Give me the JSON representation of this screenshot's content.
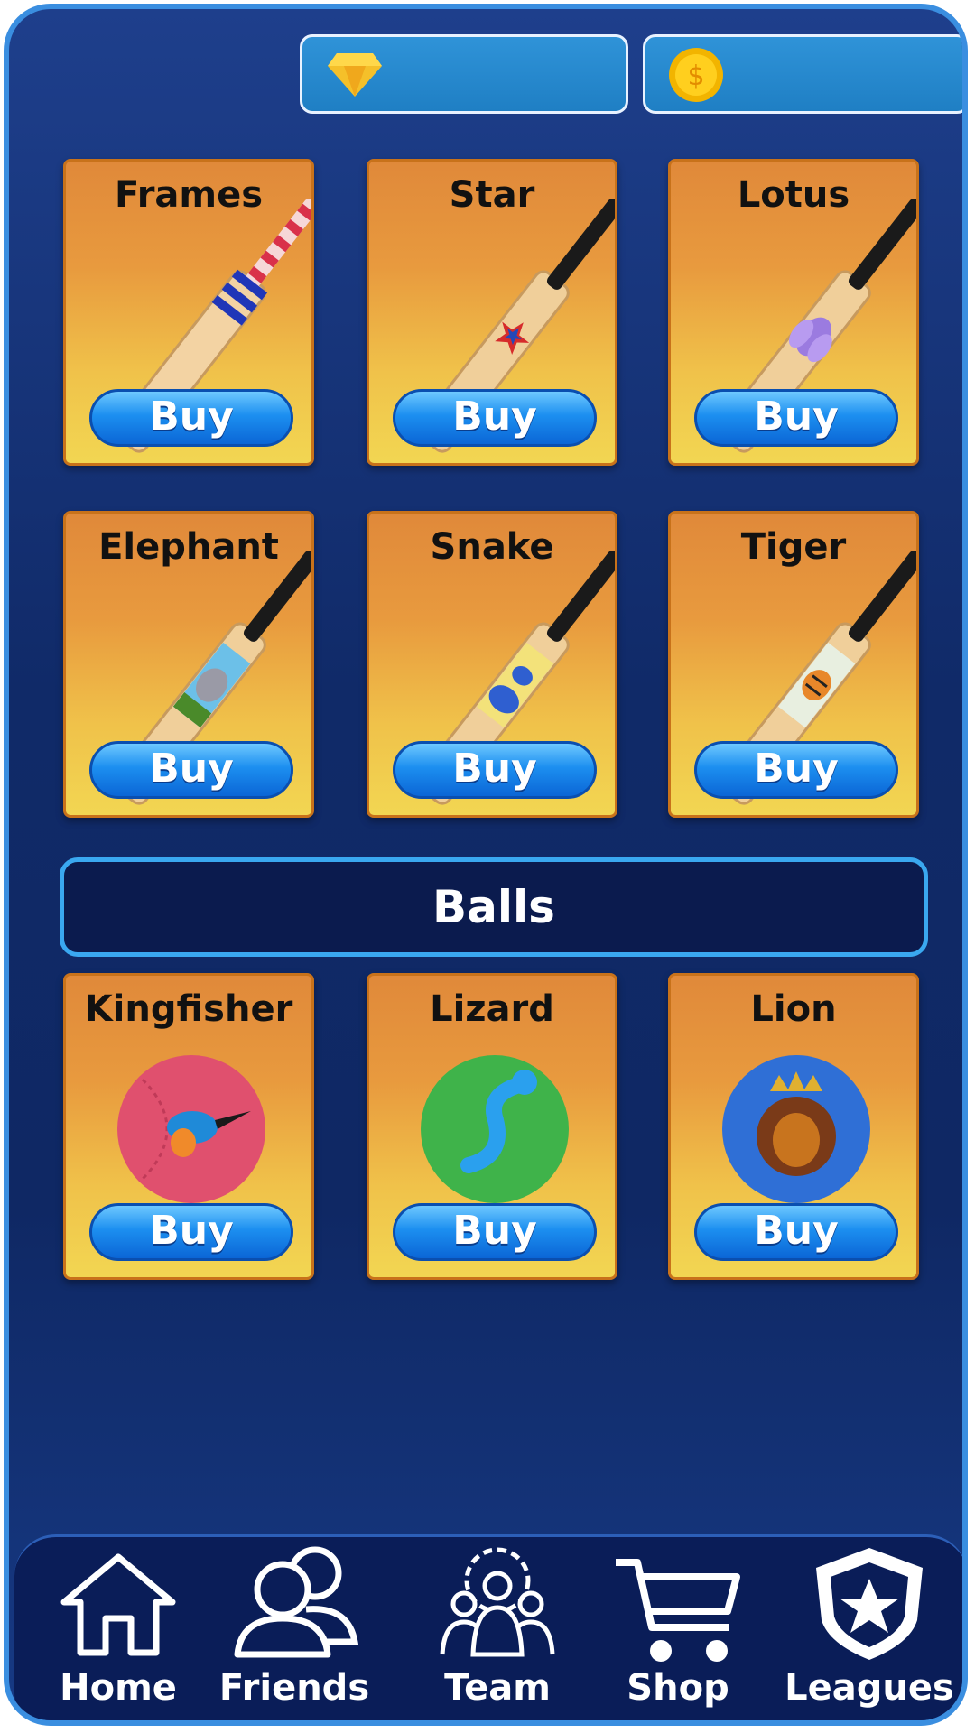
{
  "currency": {
    "gems": {
      "icon": "diamond-icon",
      "value": ""
    },
    "coins": {
      "icon": "coin-icon",
      "value": ""
    }
  },
  "bats": [
    {
      "name": "Frames",
      "button": "Buy",
      "icon": "bat-frames-icon"
    },
    {
      "name": "Star",
      "button": "Buy",
      "icon": "bat-star-icon"
    },
    {
      "name": "Lotus",
      "button": "Buy",
      "icon": "bat-lotus-icon"
    },
    {
      "name": "Elephant",
      "button": "Buy",
      "icon": "bat-elephant-icon"
    },
    {
      "name": "Snake",
      "button": "Buy",
      "icon": "bat-snake-icon"
    },
    {
      "name": "Tiger",
      "button": "Buy",
      "icon": "bat-tiger-icon"
    }
  ],
  "balls_section": {
    "title": "Balls"
  },
  "balls": [
    {
      "name": "Kingfisher",
      "button": "Buy",
      "icon": "ball-kingfisher-icon",
      "color": "#e0506e"
    },
    {
      "name": "Lizard",
      "button": "Buy",
      "icon": "ball-lizard-icon",
      "color": "#3fb34a"
    },
    {
      "name": "Lion",
      "button": "Buy",
      "icon": "ball-lion-icon",
      "color": "#2f6fd6"
    }
  ],
  "nav": [
    {
      "label": "Home",
      "icon": "home-icon"
    },
    {
      "label": "Friends",
      "icon": "friends-icon"
    },
    {
      "label": "Team",
      "icon": "team-icon"
    },
    {
      "label": "Shop",
      "icon": "cart-icon"
    },
    {
      "label": "Leagues",
      "icon": "shield-star-icon"
    }
  ],
  "colors": {
    "accent": "#3a8ee0",
    "background": "#102a68",
    "card": "#e89a3e",
    "buy_button": "#1c8ff0"
  }
}
